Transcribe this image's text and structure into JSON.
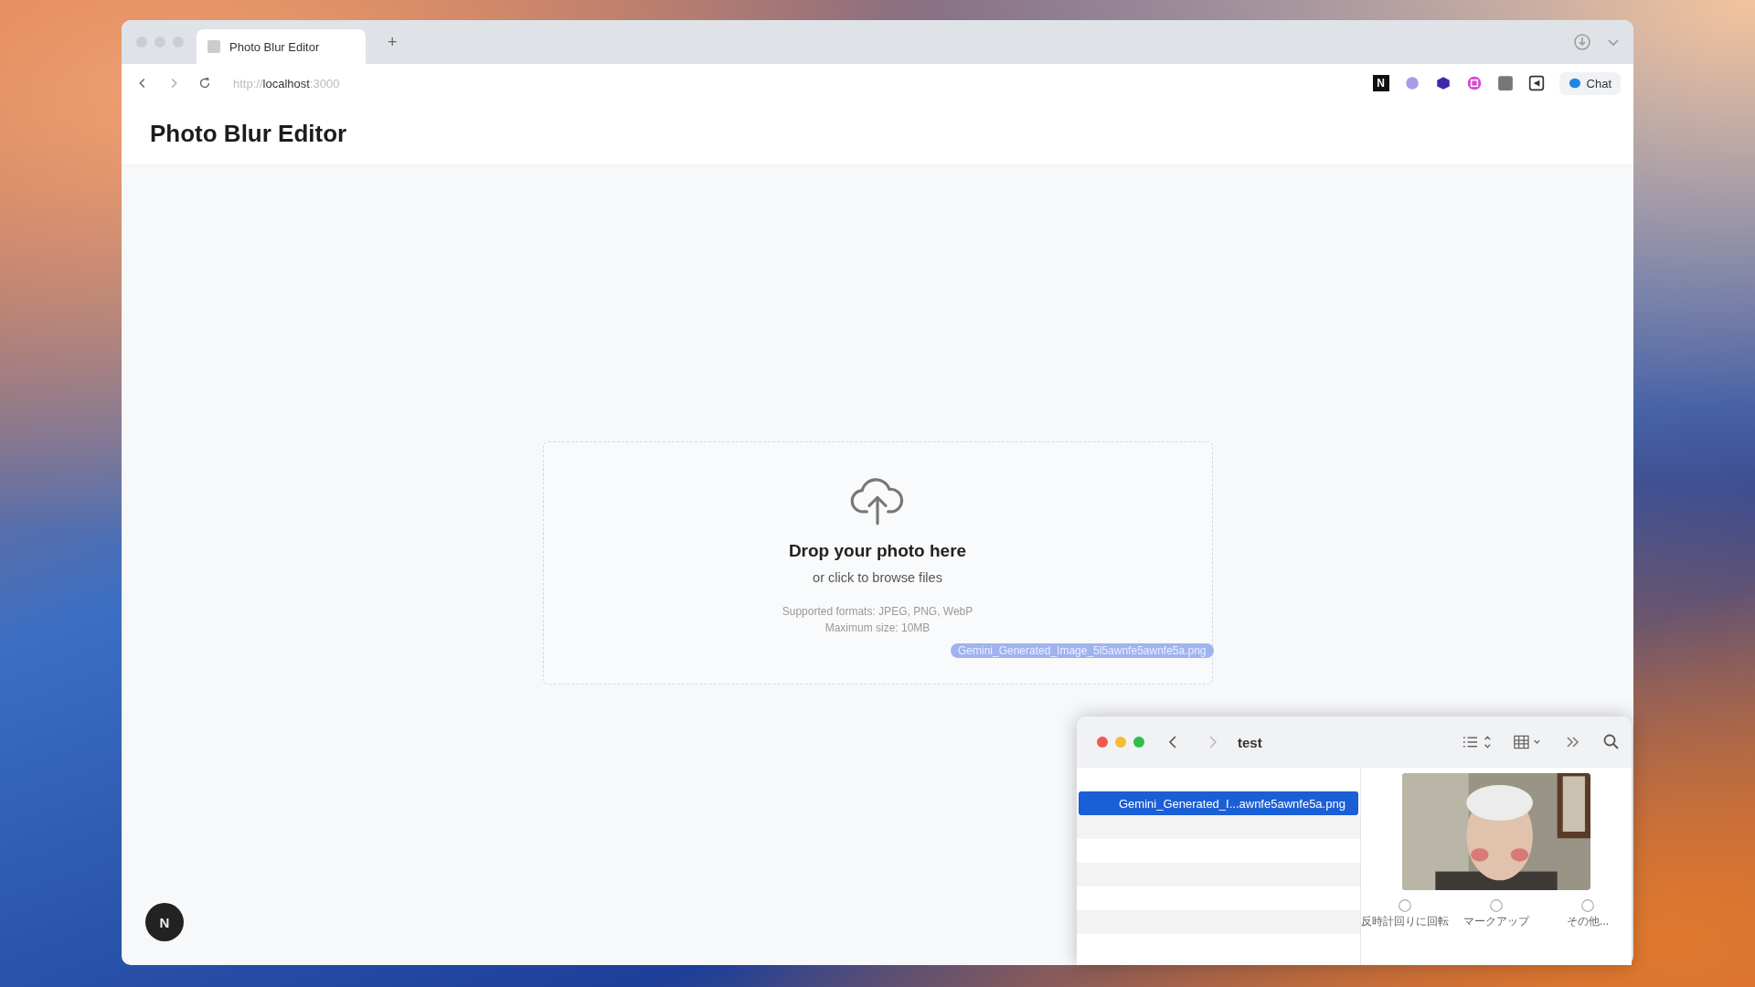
{
  "browser": {
    "tabs": [
      {
        "title": "Photo Blur Editor",
        "selected": true
      }
    ],
    "new_tab": "+",
    "url": {
      "scheme": "http://",
      "host": "localhost",
      "port": ":3000"
    },
    "extension_letter": "N",
    "chat_button": "Chat"
  },
  "page": {
    "title": "Photo Blur Editor",
    "dropzone": {
      "heading": "Drop your photo here",
      "subheading": "or click to browse files",
      "formats": "Supported formats: JPEG, PNG, WebP",
      "max_size": "Maximum size: 10MB"
    },
    "dev_badge": "N"
  },
  "drag": {
    "file_label": "Gemini_Generated_Image_5l5awnfe5awnfe5a.png"
  },
  "finder": {
    "title": "test",
    "files": [
      {
        "name": "Gemini_Generated_I...awnfe5awnfe5a.png",
        "selected": true
      }
    ],
    "actions": [
      {
        "label": "反時計回りに回転"
      },
      {
        "label": "マークアップ"
      },
      {
        "label": "その他..."
      }
    ]
  }
}
